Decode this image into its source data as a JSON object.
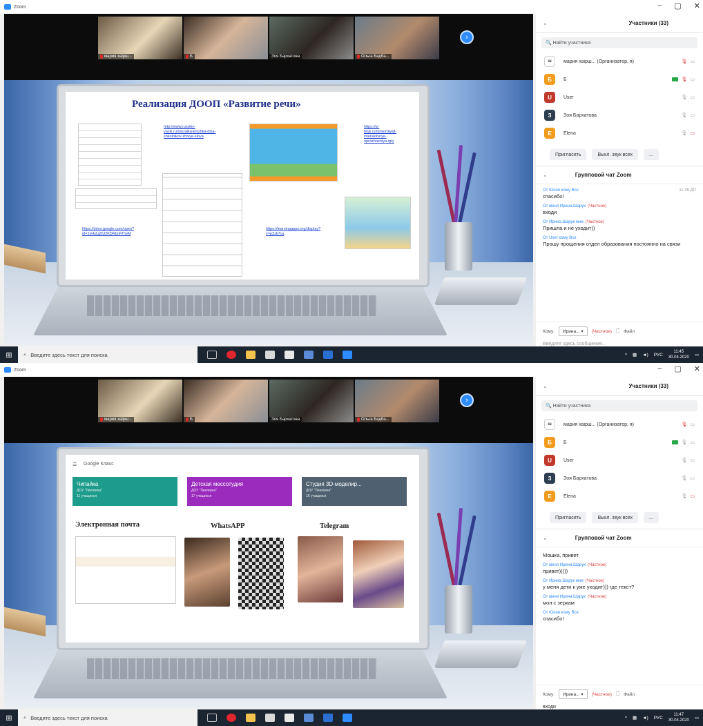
{
  "shot1": {
    "window_title": "Zoom",
    "gallery": [
      {
        "name": "мария хаірш..."
      },
      {
        "name": "Б"
      },
      {
        "name": "Зоя Бархатова"
      },
      {
        "name": "Ольга Бедба..."
      }
    ],
    "slide": {
      "title": "Реализация ДООП «Развитие речи»",
      "links": [
        "http://www.russkiy-yazik.ru/mozaika-knizhka-dlya-shkolnikov-zhivye-slova",
        "https://iz-bryk.com/wordwall-interaktivnye-uprazhneniya-igry",
        "https://learningapps.org/display?v=p2zk7ca",
        "https://drive.google.com/open?id=1vHsLg5U2KDRbnFf7wM",
        "https://learningapps.org/watch?v=pqe7qv2a520"
      ]
    },
    "participants_panel": {
      "title": "Участники (33)",
      "search_placeholder": "Найти участника",
      "participants": [
        {
          "avatar": "",
          "name": "мария хаірш... (Организатор, я)",
          "color": "#ffffff"
        },
        {
          "avatar": "Б",
          "name": "Б",
          "color": "#f29b1d"
        },
        {
          "avatar": "U",
          "name": "User",
          "color": "#c0392b"
        },
        {
          "avatar": "З",
          "name": "Зоя Бархатова",
          "color": "#2c3e50"
        },
        {
          "avatar": "E",
          "name": "Elena",
          "color": "#f29b1d"
        }
      ],
      "invite_label": "Пригласить",
      "mute_all_label": "Выкл. звук всех",
      "more_label": "..."
    },
    "chat": {
      "title": "Групповой чат Zoom",
      "messages": [
        {
          "from": "От Юлия кому Все",
          "private": "",
          "time": "11:35 ДП",
          "text": "спасибо!"
        },
        {
          "from": "От меня Ирина Шарук:",
          "private": "(Частное)",
          "time": "",
          "text": "входи"
        },
        {
          "from": "От Ирина Шарук мне:",
          "private": "(Частное)",
          "time": "",
          "text": "Пришла и не уходит))"
        },
        {
          "from": "От User кому Все",
          "private": "",
          "time": "",
          "text": "Прошу прощения отдел образования постоянно на связи"
        }
      ],
      "to_label": "Кому:",
      "to_value": "Ирина... ▾",
      "private_label": "(Частное)",
      "file_label": "Файл",
      "input_placeholder": "Введите здесь сообщение..."
    },
    "taskbar": {
      "search_placeholder": "Введите здесь текст для поиска",
      "lang": "РУС",
      "time": "11:45",
      "date": "30.04.2020"
    }
  },
  "shot2": {
    "window_title": "Zoom",
    "gallery": [
      {
        "name": "мария хаірш..."
      },
      {
        "name": "Б"
      },
      {
        "name": "Зоя Бархатова"
      },
      {
        "name": "Ольга Бедба..."
      }
    ],
    "slide": {
      "app_title": "Google Класс",
      "cards": [
        {
          "title": "Чипайка",
          "sub": "ДОУ \"Лингвина\"",
          "sub2": "11 учащихся",
          "color": "#1d9c8c"
        },
        {
          "title": "Детская мессотудия",
          "sub": "ДОУ \"Лингвина\"",
          "sub2": "17 учащихся",
          "color": "#9b2bbd"
        },
        {
          "title": "Студия 3D-моделир...",
          "sub": "ДОУ \"Лингвина\"",
          "sub2": "16 учащихся",
          "color": "#4f6171"
        }
      ],
      "col_titles": [
        "Электронная почта",
        "WhatsAPP",
        "Telegram"
      ]
    },
    "participants_panel": {
      "title": "Участники (33)",
      "search_placeholder": "Найти участника",
      "participants": [
        {
          "avatar": "",
          "name": "мария хаірш... (Организатор, я)",
          "color": "#ffffff"
        },
        {
          "avatar": "Б",
          "name": "Б",
          "color": "#f29b1d"
        },
        {
          "avatar": "U",
          "name": "User",
          "color": "#c0392b"
        },
        {
          "avatar": "З",
          "name": "Зоя Бархатова",
          "color": "#2c3e50"
        },
        {
          "avatar": "E",
          "name": "Elena",
          "color": "#f29b1d"
        }
      ],
      "invite_label": "Пригласить",
      "mute_all_label": "Выкл. звук всех",
      "more_label": "..."
    },
    "chat": {
      "title": "Групповой чат Zoom",
      "messages": [
        {
          "from": "",
          "private": "",
          "time": "",
          "text": "Мошка, привет"
        },
        {
          "from": "От меня Ирина Шарук:",
          "private": "(Частное)",
          "time": "",
          "text": "привет)))))"
        },
        {
          "from": "От Ирина Шарук мне:",
          "private": "(Частное)",
          "time": "",
          "text": "у меня дети к уже уходит))) где текст?"
        },
        {
          "from": "От меня Ирина Шарук:",
          "private": "(Частное)",
          "time": "",
          "text": "мон с зеркам"
        },
        {
          "from": "От Юлия кому Все",
          "private": "",
          "time": "",
          "text": "спасибо!"
        }
      ],
      "to_label": "Кому:",
      "to_value": "Ирина... ▾",
      "private_label": "(Частное)",
      "file_label": "Файл",
      "input_placeholder": "входи"
    },
    "taskbar": {
      "search_placeholder": "Введите здесь текст для поиска",
      "lang": "РУС",
      "time": "11:47",
      "date": "30.04.2020"
    }
  }
}
